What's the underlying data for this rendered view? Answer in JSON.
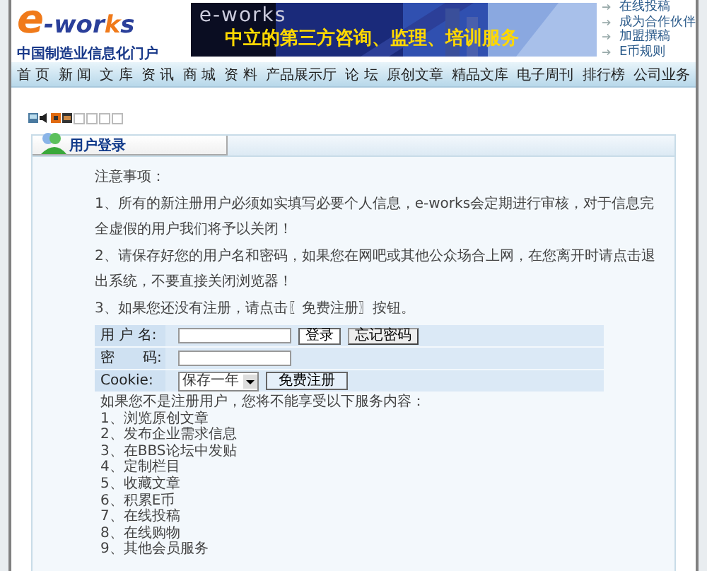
{
  "logo": {
    "text": "e-works",
    "tagline": "中国制造业信息化门户"
  },
  "banner": {
    "brand": "e-works",
    "slogan": "中立的第三方咨询、监理、培训服务"
  },
  "header_links": [
    "在线投稿",
    "成为合作伙伴",
    "加盟撰稿",
    "E币规则"
  ],
  "nav": [
    "首 页",
    "新 闻",
    "文 库",
    "资 讯",
    "商 城",
    "资 料",
    "产品展示厅",
    "论 坛",
    "原创文章",
    "精品文库",
    "电子周刊",
    "排行榜",
    "公司业务"
  ],
  "panel": {
    "tab": "用户登录",
    "notes": [
      "注意事项：",
      "1、所有的新注册用户必须如实填写必要个人信息，e-works会定期进行审核，对于信息完全虚假的用户我们将予以关闭！",
      "2、请保存好您的用户名和密码，如果您在网吧或其他公众场合上网，在您离开时请点击退出系统，不要直接关闭浏览器！",
      "3、如果您还没有注册，请点击〖免费注册〗按钮。"
    ],
    "form": [
      {
        "kind": "input",
        "label": "用 户 名:",
        "buttons": [
          "登录",
          "忘记密码"
        ]
      },
      {
        "kind": "input",
        "label": "密　　码:"
      },
      {
        "kind": "select",
        "label": "Cookie:",
        "value": "保存一年",
        "buttons": [
          "免费注册"
        ]
      }
    ],
    "services_intro": "如果您不是注册用户，您将不能享受以下服务内容：",
    "services": [
      "1、浏览原创文章",
      "2、发布企业需求信息",
      "3、在BBS论坛中发贴",
      "4、定制栏目",
      "5、收藏文章",
      "6、积累E币",
      "7、在线投稿",
      "8、在线购物",
      "9、其他会员服务"
    ]
  }
}
